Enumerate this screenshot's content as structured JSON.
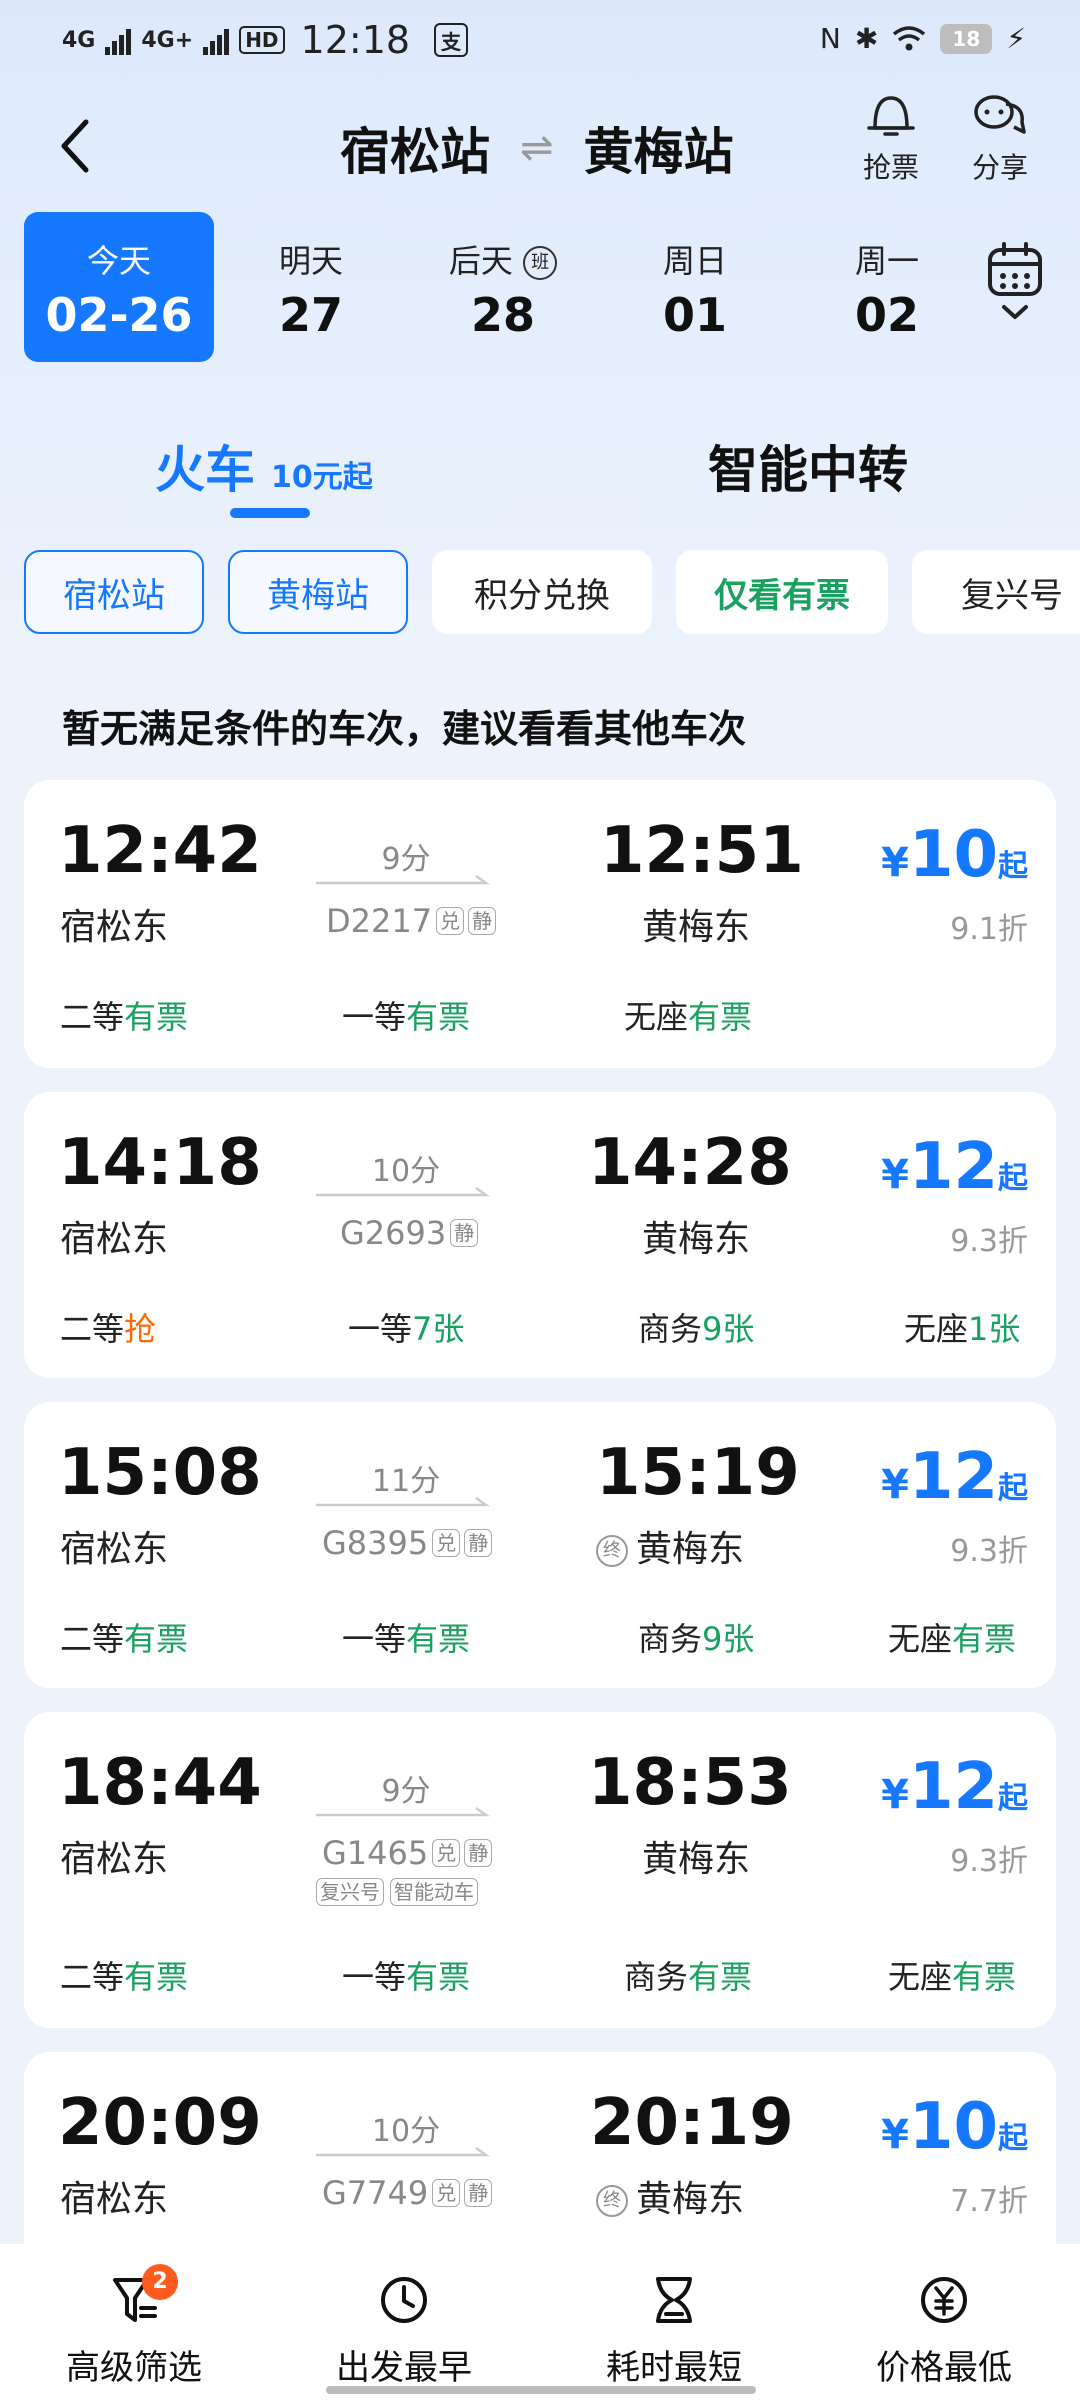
{
  "status_bar": {
    "net1": "4G",
    "net2": "4G+",
    "hd": "HD",
    "time": "12:18",
    "app_glyph": "支",
    "battery": "18"
  },
  "header": {
    "from": "宿松站",
    "to": "黄梅站",
    "grab_label": "抢票",
    "share_label": "分享"
  },
  "dates": [
    {
      "top": "今天",
      "bottom": "02-26",
      "active": true
    },
    {
      "top": "明天",
      "bottom": "27"
    },
    {
      "top": "后天",
      "badge": "班",
      "bottom": "28"
    },
    {
      "top": "周日",
      "bottom": "01"
    },
    {
      "top": "周一",
      "bottom": "02"
    }
  ],
  "tabs": {
    "train": "火车",
    "train_sub": "10元起",
    "transfer": "智能中转"
  },
  "filters": [
    "宿松站",
    "黄梅站",
    "积分兑换",
    "仅看有票",
    "复兴号"
  ],
  "notice": "暂无满足条件的车次，建议看看其他车次",
  "trains": [
    {
      "dep": "12:42",
      "dep_station": "宿松东",
      "duration": "9分",
      "no": "D2217",
      "tags": [
        "兑",
        "静"
      ],
      "arr": "12:51",
      "arr_station": "黄梅东",
      "yen": "¥",
      "price": "10",
      "qi": "起",
      "discount": "9.1折",
      "seats": [
        {
          "name": "二等",
          "status": "有票"
        },
        {
          "name": "一等",
          "status": "有票"
        },
        {
          "name": "无座",
          "status": "有票"
        }
      ]
    },
    {
      "dep": "14:18",
      "dep_station": "宿松东",
      "duration": "10分",
      "no": "G2693",
      "tags": [
        "静"
      ],
      "arr": "14:28",
      "arr_station": "黄梅东",
      "yen": "¥",
      "price": "12",
      "qi": "起",
      "discount": "9.3折",
      "seats": [
        {
          "name": "二等",
          "status": "抢"
        },
        {
          "name": "一等",
          "status": "7张"
        },
        {
          "name": "商务",
          "status": "9张"
        },
        {
          "name": "无座",
          "status": "1张"
        }
      ]
    },
    {
      "dep": "15:08",
      "dep_station": "宿松东",
      "duration": "11分",
      "no": "G8395",
      "tags": [
        "兑",
        "静"
      ],
      "arr_ring": "终",
      "arr": "15:19",
      "arr_station": "黄梅东",
      "yen": "¥",
      "price": "12",
      "qi": "起",
      "discount": "9.3折",
      "seats": [
        {
          "name": "二等",
          "status": "有票"
        },
        {
          "name": "一等",
          "status": "有票"
        },
        {
          "name": "商务",
          "status": "9张"
        },
        {
          "name": "无座",
          "status": "有票"
        }
      ]
    },
    {
      "dep": "18:44",
      "dep_station": "宿松东",
      "duration": "9分",
      "no": "G1465",
      "tags": [
        "兑",
        "静"
      ],
      "tags2": [
        "复兴号",
        "智能动车"
      ],
      "arr": "18:53",
      "arr_station": "黄梅东",
      "yen": "¥",
      "price": "12",
      "qi": "起",
      "discount": "9.3折",
      "seats": [
        {
          "name": "二等",
          "status": "有票"
        },
        {
          "name": "一等",
          "status": "有票"
        },
        {
          "name": "商务",
          "status": "有票"
        },
        {
          "name": "无座",
          "status": "有票"
        }
      ]
    },
    {
      "dep": "20:09",
      "dep_station": "宿松东",
      "duration": "10分",
      "no": "G7749",
      "tags": [
        "兑",
        "静"
      ],
      "arr_ring": "终",
      "arr": "20:19",
      "arr_station": "黄梅东",
      "yen": "¥",
      "price": "10",
      "qi": "起",
      "discount": "7.7折",
      "seats": []
    }
  ],
  "bottom_bar": {
    "filter": "高级筛选",
    "filter_badge": "2",
    "earliest": "出发最早",
    "shortest": "耗时最短",
    "lowest": "价格最低"
  },
  "colors": {
    "accent": "#1677ff",
    "available": "#19a15f",
    "grab": "#ff6a00",
    "badge": "#ff5a1f"
  }
}
